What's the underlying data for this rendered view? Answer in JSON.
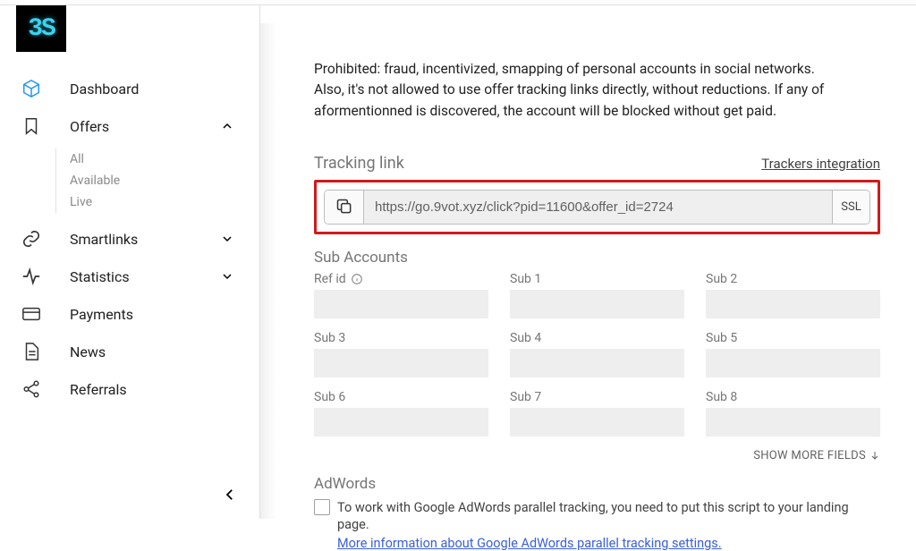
{
  "logo": {
    "text": "3S"
  },
  "sidebar": {
    "items": [
      {
        "label": "Dashboard"
      },
      {
        "label": "Offers",
        "expanded": true,
        "children": [
          "All",
          "Available",
          "Live"
        ]
      },
      {
        "label": "Smartlinks"
      },
      {
        "label": "Statistics"
      },
      {
        "label": "Payments"
      },
      {
        "label": "News"
      },
      {
        "label": "Referrals"
      }
    ]
  },
  "content": {
    "notice": "Prohibited: fraud, incentivized, smapping of personal accounts in social networks. Also, it's not allowed to use offer tracking links directly, without reductions. If any of aformentionned is discovered, the account will be blocked without get paid.",
    "tracking": {
      "title": "Tracking link",
      "integration_label": "Trackers integration",
      "url": "https://go.9vot.xyz/click?pid=11600&offer_id=2724",
      "ssl_label": "SSL"
    },
    "sub_accounts": {
      "title": "Sub Accounts",
      "fields": [
        "Ref id",
        "Sub 1",
        "Sub 2",
        "Sub 3",
        "Sub 4",
        "Sub 5",
        "Sub 6",
        "Sub 7",
        "Sub 8"
      ],
      "show_more": "SHOW MORE FIELDS"
    },
    "adwords": {
      "title": "AdWords",
      "text": "To work with Google AdWords parallel tracking, you need to put this script to your landing page.",
      "link": "More information about Google AdWords parallel tracking settings."
    }
  }
}
